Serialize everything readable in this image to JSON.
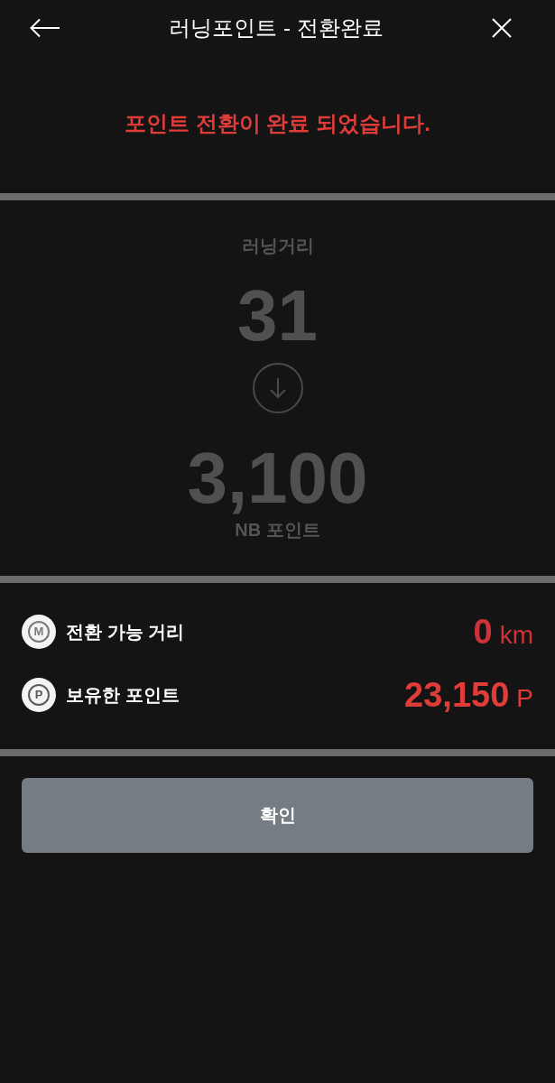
{
  "header": {
    "title": "러닝포인트 - 전환완료"
  },
  "message": "포인트 전환이 완료 되었습니다.",
  "conversion": {
    "from_label": "러닝거리",
    "from_value": "31",
    "to_value": "3,100",
    "to_label": "NB 포인트"
  },
  "balances": [
    {
      "kind": "distance",
      "icon_letter": "M",
      "label": "전환 가능 거리",
      "value": "0",
      "unit": "km"
    },
    {
      "kind": "points",
      "icon_letter": "P",
      "label": "보유한 포인트",
      "value": "23,150",
      "unit": "P"
    }
  ],
  "buttons": [
    {
      "label": "확인"
    }
  ]
}
